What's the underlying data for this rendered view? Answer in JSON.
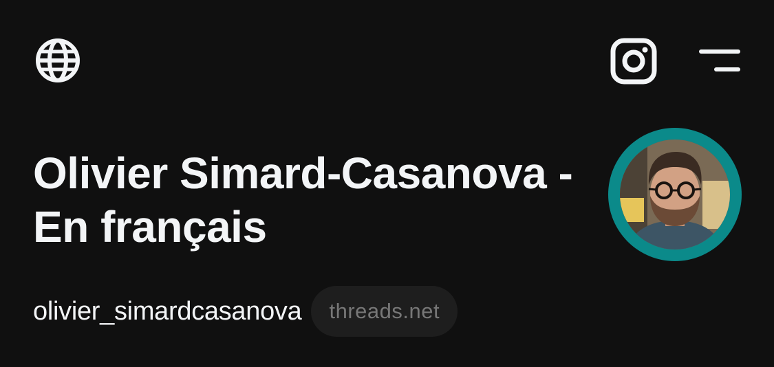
{
  "header": {
    "icons": {
      "language": "globe-icon",
      "instagram": "instagram-icon",
      "menu": "menu-icon"
    }
  },
  "profile": {
    "name": "Olivier Simard-Casanova - En français",
    "username": "olivier_simardcasanova",
    "domain": "threads.net",
    "avatar_icon": "profile-photo"
  },
  "colors": {
    "background": "#101010",
    "text": "#f3f5f7",
    "avatar_ring": "#0b8a8a",
    "badge_bg": "#1e1e1e",
    "badge_text": "#777777"
  }
}
